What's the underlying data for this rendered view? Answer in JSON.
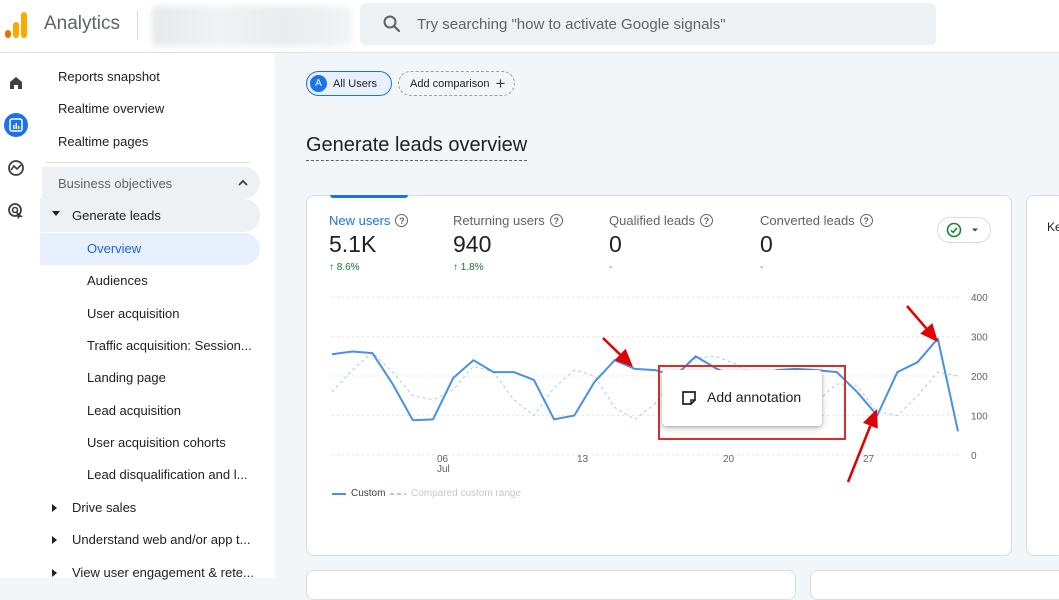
{
  "header": {
    "app_title": "Analytics",
    "search_placeholder": "Try searching \"how to activate Google signals\""
  },
  "rail": [
    "home-icon",
    "reports-icon",
    "explore-icon",
    "advertising-icon"
  ],
  "sidebar": {
    "top_items": [
      "Reports snapshot",
      "Realtime overview",
      "Realtime pages"
    ],
    "section_label": "Business objectives",
    "group_label": "Generate leads",
    "active_item": "Overview",
    "sub_items": [
      "Audiences",
      "User acquisition",
      "Traffic acquisition: Session...",
      "Landing page",
      "Lead acquisition",
      "User acquisition cohorts",
      "Lead disqualification and l..."
    ],
    "collapsed_groups": [
      "Drive sales",
      "Understand web and/or app t...",
      "View user engagement & rete..."
    ]
  },
  "main": {
    "chip_badge": "A",
    "chip_users": "All Users",
    "chip_compare": "Add comparison",
    "page_title": "Generate leads overview",
    "metrics": [
      {
        "label": "New users",
        "value": "5.1K",
        "change": "↑ 8.6%"
      },
      {
        "label": "Returning users",
        "value": "940",
        "change": "↑ 1.8%"
      },
      {
        "label": "Qualified leads",
        "value": "0",
        "change": "-"
      },
      {
        "label": "Converted leads",
        "value": "0",
        "change": "-"
      }
    ],
    "right_card_label": "Ke",
    "annotation_label": "Add annotation",
    "legend_custom": "Custom",
    "legend_compared": "Compared custom range"
  },
  "chart_data": {
    "type": "line",
    "x_ticks": [
      "06",
      "13",
      "20",
      "27"
    ],
    "x_tick_sub": "Jul",
    "y_ticks": [
      "400",
      "300",
      "200",
      "100",
      "0"
    ],
    "ylim": [
      0,
      400
    ],
    "series": [
      {
        "name": "Custom",
        "color": "#4a90e2",
        "style": "solid",
        "values": [
          255,
          262,
          258,
          180,
          88,
          90,
          195,
          240,
          210,
          210,
          190,
          90,
          100,
          185,
          240,
          218,
          215,
          200,
          250,
          220,
          195,
          175,
          215,
          218,
          215,
          210,
          160,
          100,
          210,
          235,
          295,
          60
        ]
      },
      {
        "name": "Compared custom range",
        "color": "#a8c7fa",
        "style": "dashed",
        "values": [
          160,
          215,
          260,
          210,
          150,
          140,
          165,
          225,
          210,
          140,
          100,
          170,
          215,
          200,
          120,
          90,
          130,
          200,
          245,
          250,
          230,
          195,
          140,
          120,
          135,
          180,
          175,
          110,
          100,
          150,
          210,
          200
        ]
      }
    ]
  }
}
